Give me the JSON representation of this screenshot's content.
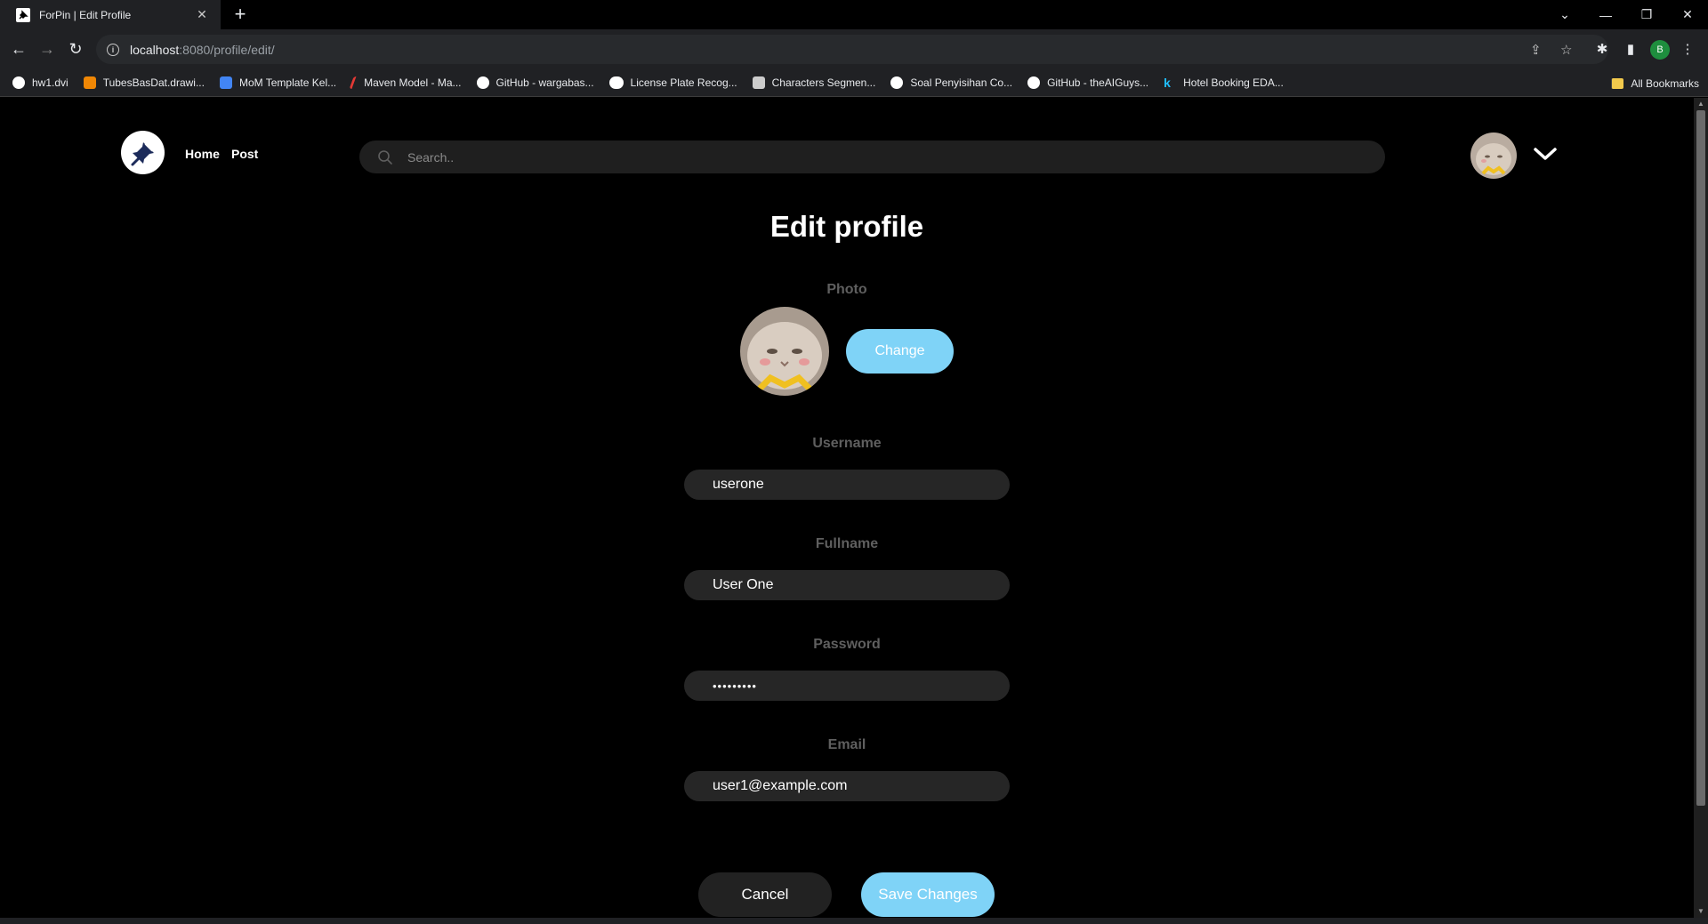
{
  "browser": {
    "tab_title": "ForPin | Edit Profile",
    "url_host": "localhost",
    "url_rest": ":8080/profile/edit/",
    "profile_initial": "B",
    "bookmarks": [
      {
        "label": "hw1.dvi",
        "color": "#ffffff"
      },
      {
        "label": "TubesBasDat.drawi...",
        "color": "#f08705"
      },
      {
        "label": "MoM Template Kel...",
        "color": "#4285f4"
      },
      {
        "label": "Maven Model - Ma...",
        "color": "#e53935"
      },
      {
        "label": "GitHub - wargabas...",
        "color": "#ffffff"
      },
      {
        "label": "License Plate Recog...",
        "color": "#ffffff"
      },
      {
        "label": "Characters Segmen...",
        "color": "#cccccc"
      },
      {
        "label": "Soal Penyisihan Co...",
        "color": "#ffffff"
      },
      {
        "label": "GitHub - theAIGuys...",
        "color": "#ffffff"
      },
      {
        "label": "Hotel Booking EDA...",
        "color": "#20beff"
      }
    ],
    "all_bookmarks": "All Bookmarks"
  },
  "nav": {
    "home": "Home",
    "post": "Post",
    "search_placeholder": "Search.."
  },
  "form": {
    "heading": "Edit profile",
    "photo_label": "Photo",
    "change_label": "Change",
    "username_label": "Username",
    "username_value": "userone",
    "fullname_label": "Fullname",
    "fullname_value": "User One",
    "password_label": "Password",
    "password_value": "•••••••••",
    "email_label": "Email",
    "email_value": "user1@example.com",
    "cancel_label": "Cancel",
    "save_label": "Save Changes"
  },
  "colors": {
    "accent": "#7fd3f7",
    "background": "#000000",
    "input_bg": "#262626"
  }
}
